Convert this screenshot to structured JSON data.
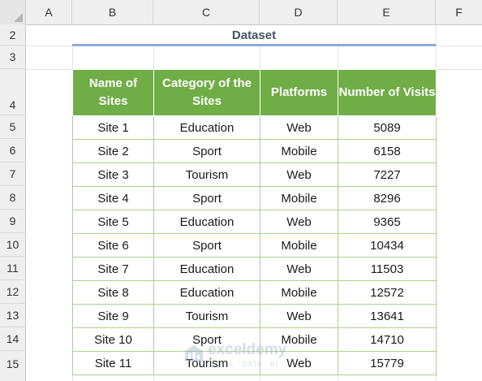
{
  "columns": [
    "A",
    "B",
    "C",
    "D",
    "E",
    "F"
  ],
  "rows": [
    "2",
    "3",
    "4",
    "5",
    "6",
    "7",
    "8",
    "9",
    "10",
    "11",
    "12",
    "13",
    "14",
    "15"
  ],
  "title": "Dataset",
  "table": {
    "headers": [
      "Name of Sites",
      "Category of the Sites",
      "Platforms",
      "Number of Visits"
    ],
    "rows": [
      [
        "Site 1",
        "Education",
        "Web",
        "5089"
      ],
      [
        "Site 2",
        "Sport",
        "Mobile",
        "6158"
      ],
      [
        "Site 3",
        "Tourism",
        "Web",
        "7227"
      ],
      [
        "Site 4",
        "Sport",
        "Mobile",
        "8296"
      ],
      [
        "Site 5",
        "Education",
        "Web",
        "9365"
      ],
      [
        "Site 6",
        "Sport",
        "Mobile",
        "10434"
      ],
      [
        "Site 7",
        "Education",
        "Web",
        "11503"
      ],
      [
        "Site 8",
        "Education",
        "Mobile",
        "12572"
      ],
      [
        "Site 9",
        "Tourism",
        "Web",
        "13641"
      ],
      [
        "Site 10",
        "Sport",
        "Mobile",
        "14710"
      ],
      [
        "Site 11",
        "Tourism",
        "Web",
        "15779"
      ]
    ]
  },
  "watermark": {
    "name": "exceldemy",
    "tagline": "EXCEL · DATA · BI"
  },
  "colors": {
    "header_fill": "#70ad47",
    "header_text": "#ffffff",
    "border": "#a9d08e",
    "title": "#44546a",
    "title_underline": "#8ea9db"
  }
}
